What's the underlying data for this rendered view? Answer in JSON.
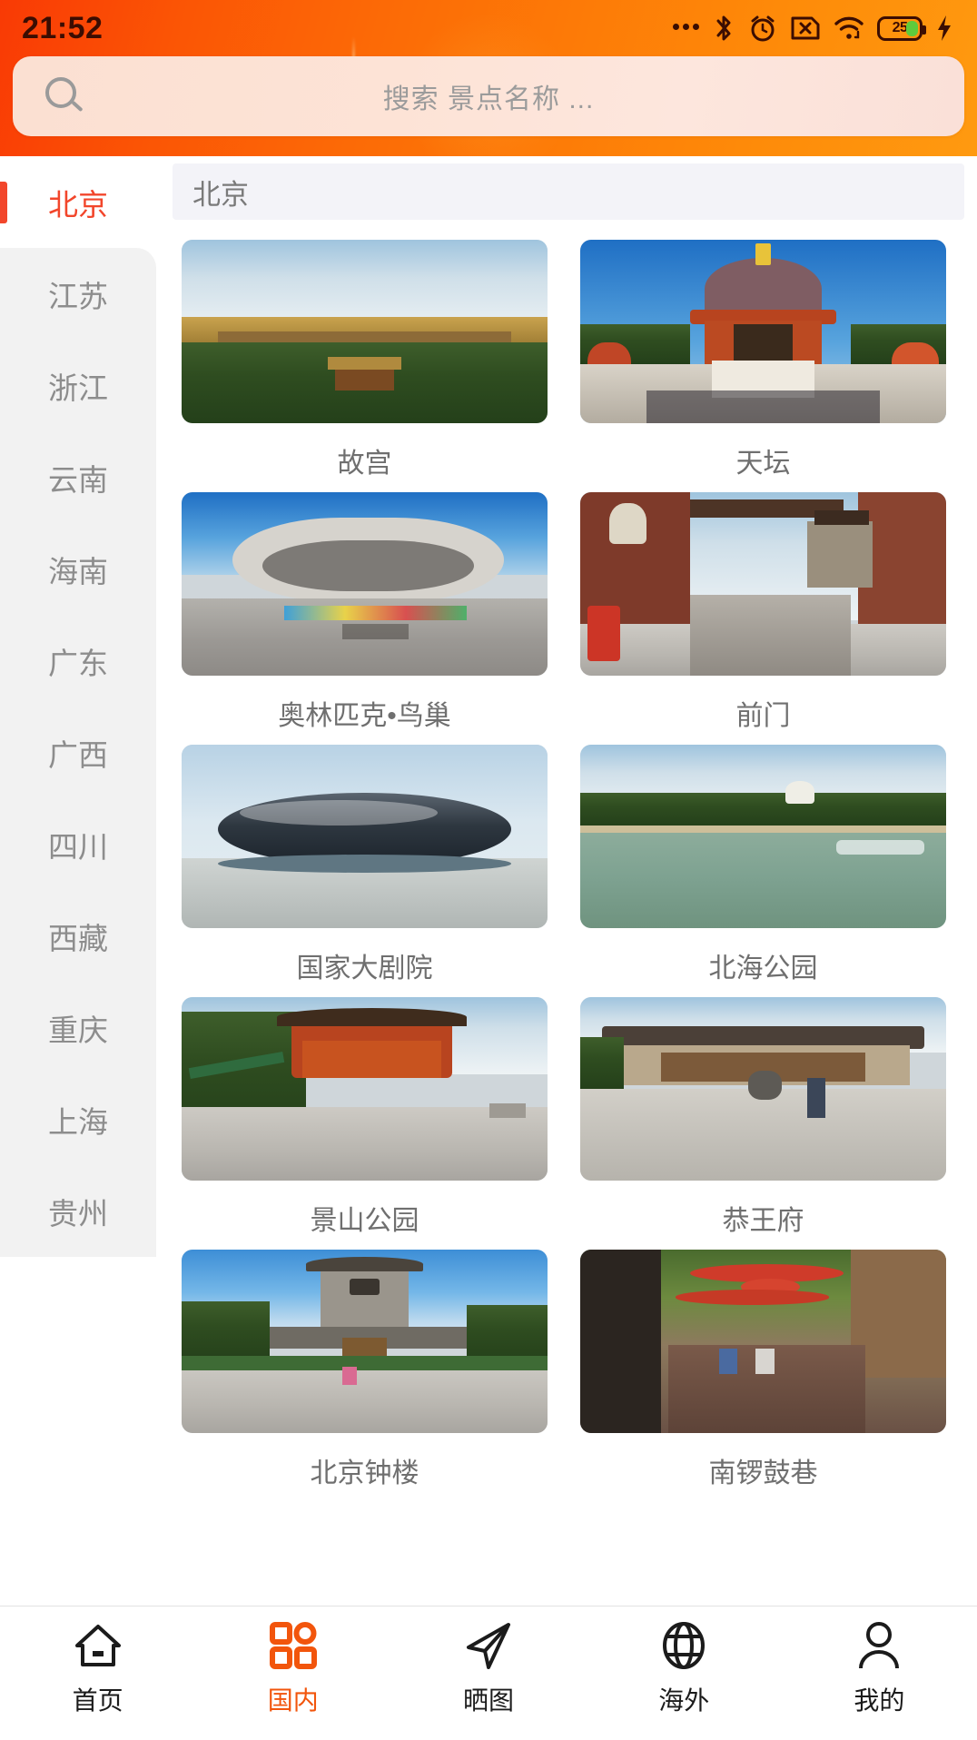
{
  "status_bar": {
    "time": "21:52",
    "battery_level": "25",
    "icons": [
      "more-dots-icon",
      "bluetooth-icon",
      "alarm-clock-icon",
      "sim-card-off-icon",
      "wifi-icon",
      "battery-icon",
      "charging-bolt-icon"
    ]
  },
  "search": {
    "placeholder": "搜索 景点名称 ...",
    "value": "",
    "icon": "search-icon"
  },
  "sidebar": {
    "active_index": 0,
    "items": [
      {
        "label": "北京"
      },
      {
        "label": "江苏"
      },
      {
        "label": "浙江"
      },
      {
        "label": "云南"
      },
      {
        "label": "海南"
      },
      {
        "label": "广东"
      },
      {
        "label": "广西"
      },
      {
        "label": "四川"
      },
      {
        "label": "西藏"
      },
      {
        "label": "重庆"
      },
      {
        "label": "上海"
      },
      {
        "label": "贵州"
      }
    ]
  },
  "content": {
    "region_title": "北京",
    "cards": [
      {
        "caption": "故宫",
        "scene": "forbidden-city"
      },
      {
        "caption": "天坛",
        "scene": "temple-of-heaven"
      },
      {
        "caption": "奥林匹克•鸟巢",
        "scene": "birds-nest"
      },
      {
        "caption": "前门",
        "scene": "qianmen"
      },
      {
        "caption": "国家大剧院",
        "scene": "grand-theatre"
      },
      {
        "caption": "北海公园",
        "scene": "beihai-park"
      },
      {
        "caption": "景山公园",
        "scene": "jingshan-park"
      },
      {
        "caption": "恭王府",
        "scene": "prince-gong-mansion"
      },
      {
        "caption": "北京钟楼",
        "scene": "bell-tower"
      },
      {
        "caption": "南锣鼓巷",
        "scene": "nanluoguxiang"
      }
    ]
  },
  "tabbar": {
    "active_index": 1,
    "items": [
      {
        "label": "首页",
        "icon": "home-icon"
      },
      {
        "label": "国内",
        "icon": "grid-icon"
      },
      {
        "label": "晒图",
        "icon": "paper-plane-icon"
      },
      {
        "label": "海外",
        "icon": "globe-icon"
      },
      {
        "label": "我的",
        "icon": "person-icon"
      }
    ]
  },
  "colors": {
    "brand_orange": "#f2550c",
    "accent_red": "#f2462b",
    "header_gradient_start": "#f93a05",
    "header_gradient_end": "#ff9a10",
    "battery_green": "#5ecb3c",
    "sidebar_gray": "#f2f2f2",
    "region_bar": "#f3f3f8"
  }
}
